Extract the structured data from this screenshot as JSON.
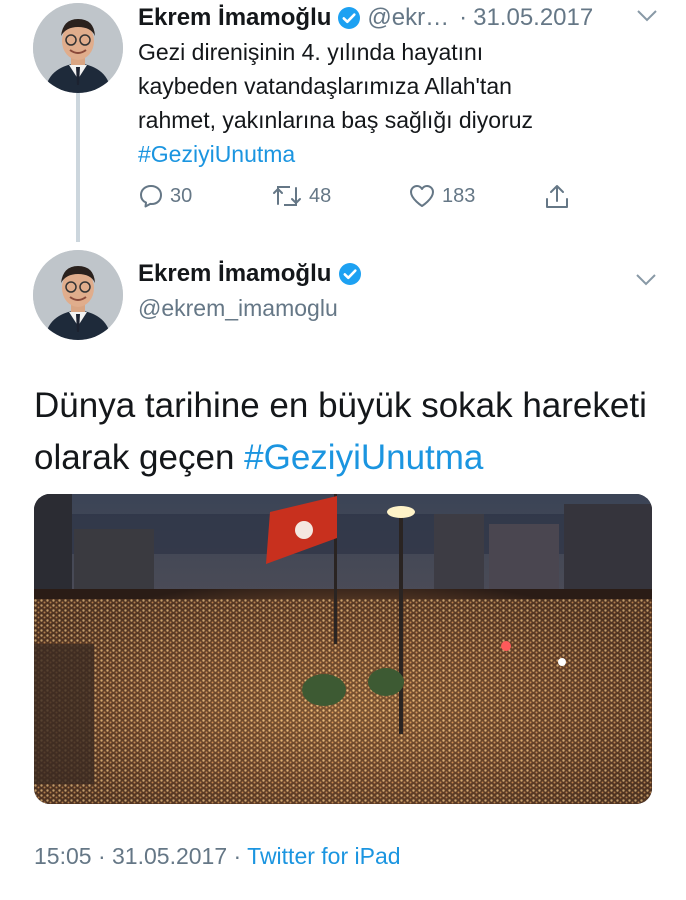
{
  "colors": {
    "link": "#1b95e0",
    "secondary_text": "#657786",
    "primary_text": "#14171a",
    "thread_line": "#ccd6dd",
    "verified_badge": "#1da1f2"
  },
  "previous_tweet": {
    "author_name": "Ekrem İmamoğlu",
    "handle": "@ekr…",
    "separator": "·",
    "date": "31.05.2017",
    "text_lines": [
      "Gezi direnişinin 4. yılında hayatını",
      "kaybeden vatandaşlarımıza Allah'tan",
      "rahmet, yakınlarına baş sağlığı diyoruz"
    ],
    "hashtag": "#GeziyiUnutma",
    "actions": {
      "reply": {
        "icon": "reply-icon",
        "count": "30"
      },
      "retweet": {
        "icon": "retweet-icon",
        "count": "48"
      },
      "like": {
        "icon": "heart-icon",
        "count": "183"
      },
      "share": {
        "icon": "share-icon"
      }
    },
    "menu_icon": "chevron-down-icon"
  },
  "main_tweet": {
    "author_name": "Ekrem İmamoğlu",
    "handle": "@ekrem_imamoglu",
    "text_line1": "Dünya tarihine en büyük sokak hareketi",
    "text_line2_prefix": "olarak geçen ",
    "hashtag": "#GeziyiUnutma",
    "menu_icon": "chevron-down-icon",
    "media": "night photo of a massive crowd in a city square with a flag",
    "timestamp": {
      "time": "15:05",
      "separator1": " · ",
      "date": "31.05.2017",
      "separator2": " · ",
      "source": "Twitter for iPad"
    }
  }
}
